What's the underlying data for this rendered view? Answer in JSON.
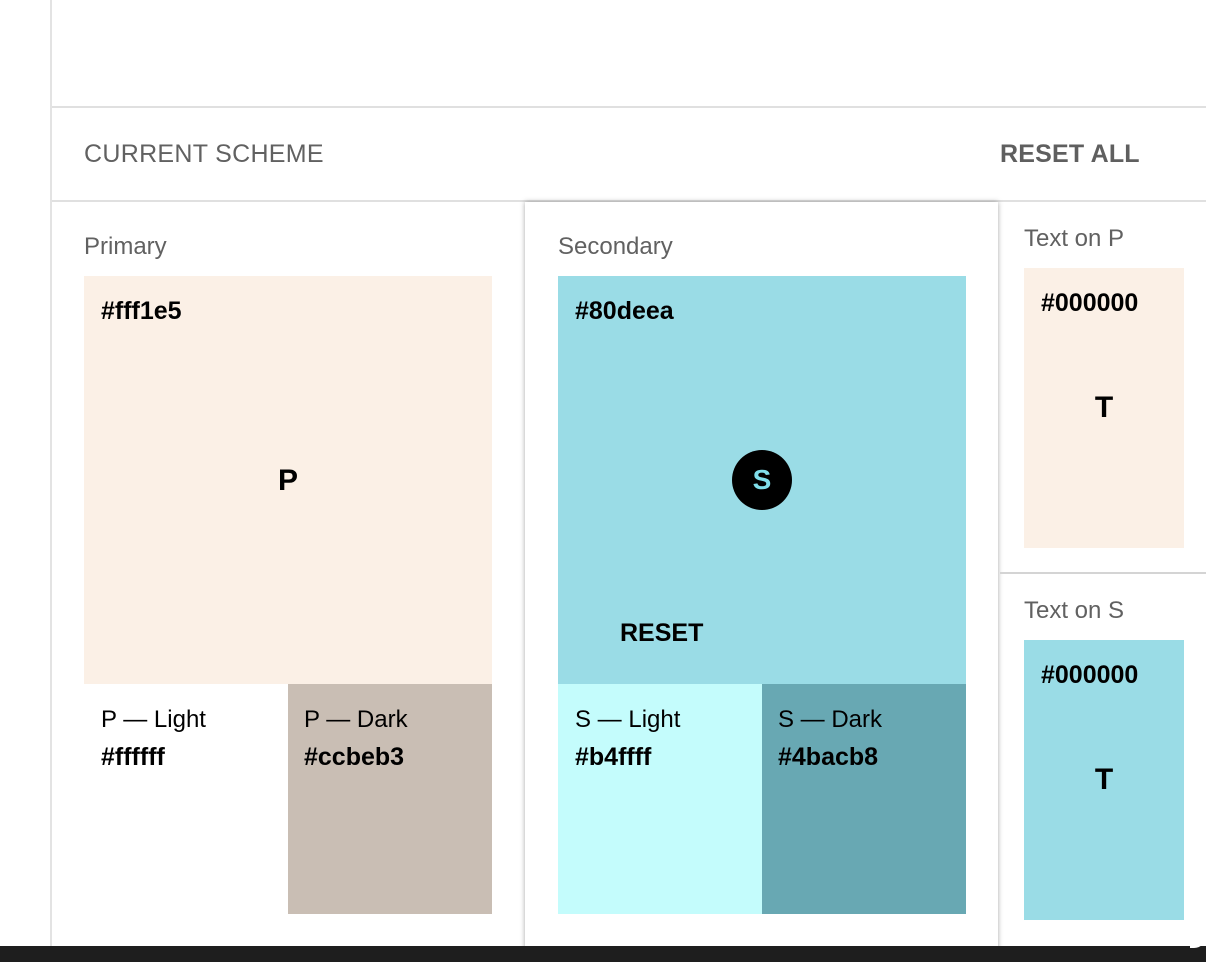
{
  "header": {
    "title": "CURRENT SCHEME",
    "reset_all_label": "RESET ALL"
  },
  "primary": {
    "label": "Primary",
    "hex": "#fff1e5",
    "letter": "P",
    "light": {
      "label": "P — Light",
      "hex": "#ffffff"
    },
    "dark": {
      "label": "P — Dark",
      "hex": "#ccbeb3"
    }
  },
  "secondary": {
    "label": "Secondary",
    "hex": "#80deea",
    "letter": "S",
    "reset_label": "RESET",
    "light": {
      "label": "S — Light",
      "hex": "#b4ffff"
    },
    "dark": {
      "label": "S — Dark",
      "hex": "#4bacb8"
    }
  },
  "text_on_p": {
    "label": "Text on P",
    "hex": "#000000",
    "letter": "T"
  },
  "text_on_s": {
    "label": "Text on S",
    "hex": "#000000",
    "letter": "T"
  },
  "colors": {
    "primary_swatch": "#fbf0e6",
    "primary_dark_swatch": "#c9beb4",
    "secondary_swatch": "#9adce6",
    "secondary_light_swatch": "#c4fcfc",
    "secondary_dark_swatch": "#68a8b3"
  }
}
